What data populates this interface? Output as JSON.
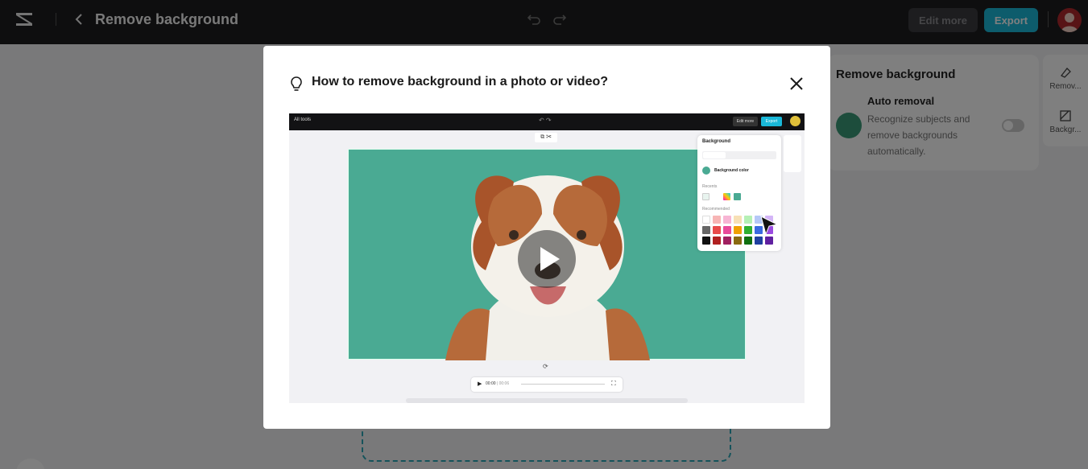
{
  "topbar": {
    "title": "Remove background",
    "edit_more": "Edit more",
    "export": "Export"
  },
  "panel": {
    "title": "Remove background",
    "auto_title": "Auto removal",
    "auto_desc": "Recognize subjects and remove backgrounds automatically."
  },
  "rail": {
    "item1": "Remov...",
    "item2": "Backgr..."
  },
  "modal": {
    "title": "How to remove background in a photo or video?"
  },
  "video": {
    "all_tools": "All tools",
    "edit_more": "Edit more",
    "export": "Export",
    "time_current": "00:00",
    "time_total": "00:06",
    "bg_panel": {
      "title": "Background",
      "color_label": "Background color",
      "recents": "Recents",
      "recommended": "Recommended"
    }
  },
  "colors": {
    "accent": "#1ab8d9",
    "canvas_bg": "#4aaa93"
  }
}
